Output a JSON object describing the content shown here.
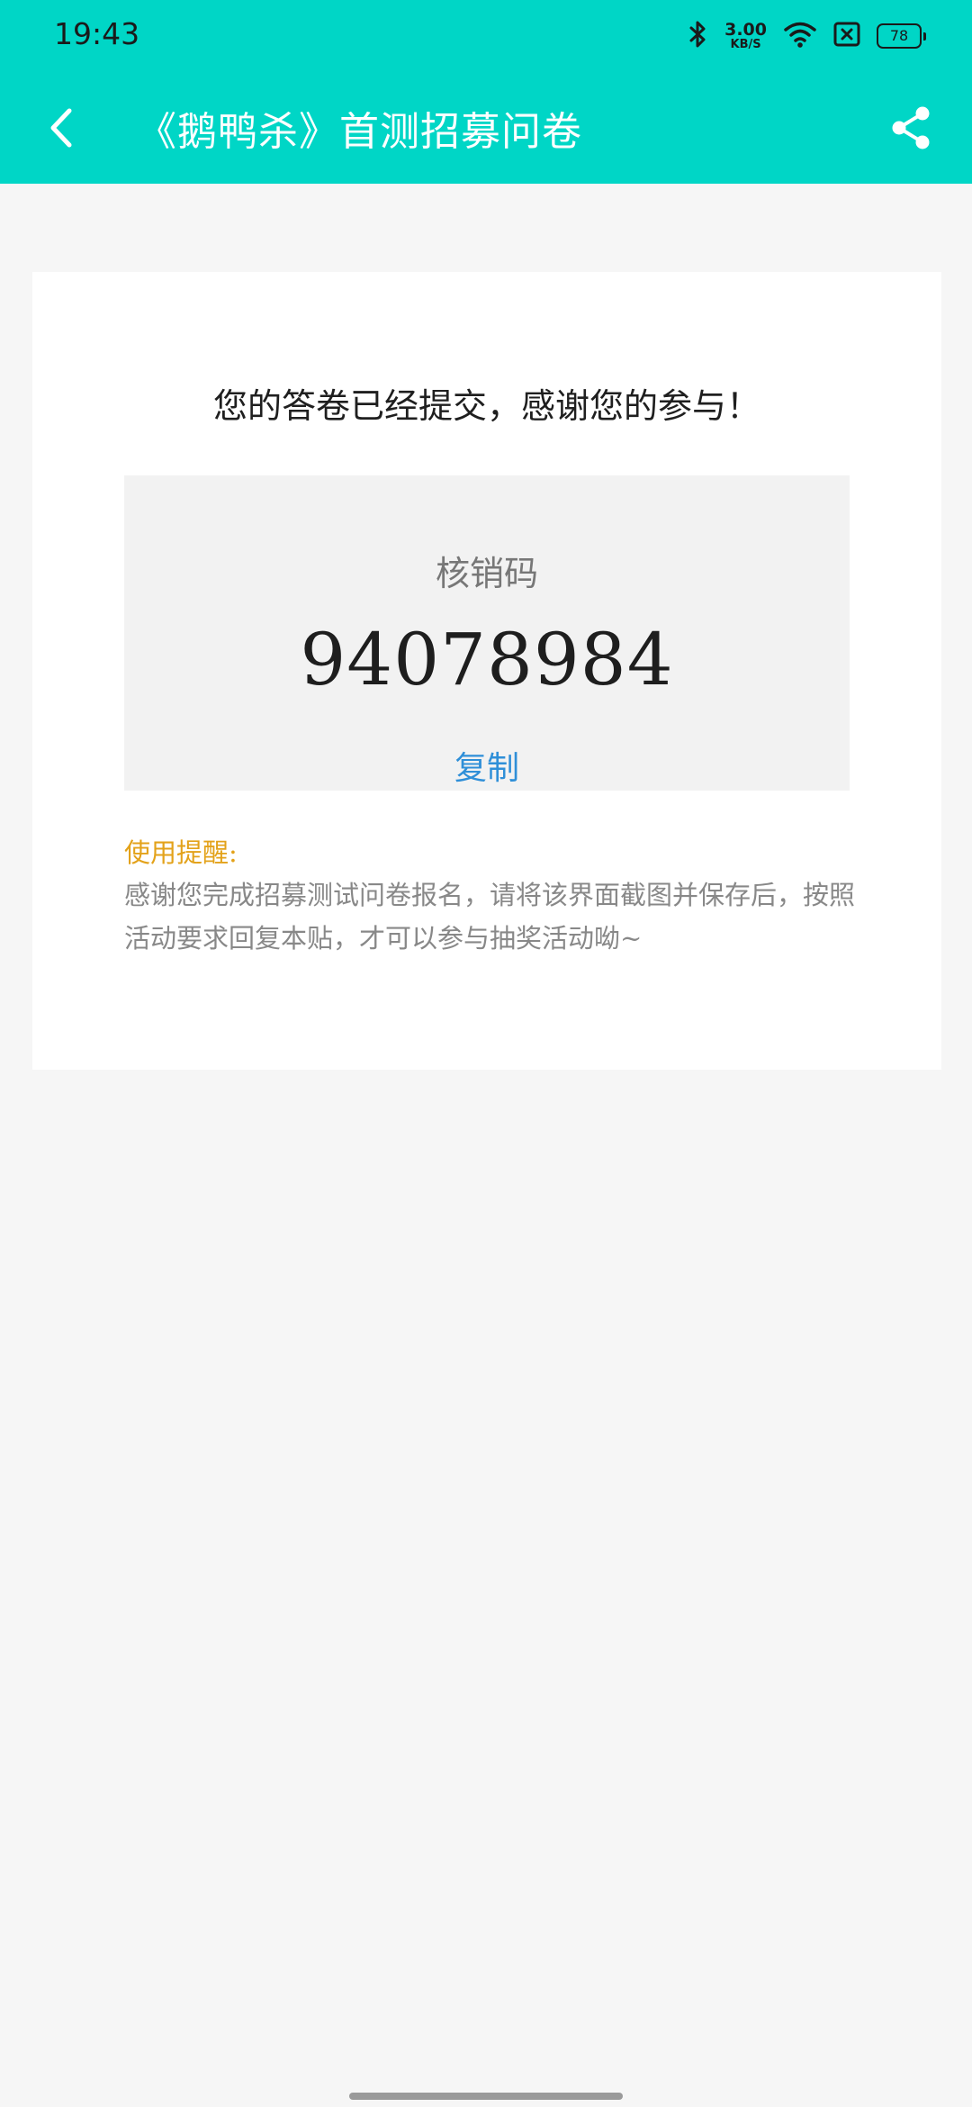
{
  "status_bar": {
    "time": "19:43",
    "net_speed_value": "3.00",
    "net_speed_unit": "KB/S",
    "battery_level": "78",
    "icons": [
      "bluetooth-icon",
      "wifi-icon",
      "sim-error-icon",
      "battery-icon"
    ]
  },
  "header": {
    "title": "《鹅鸭杀》首测招募问卷",
    "back_icon": "chevron-left-icon",
    "share_icon": "share-icon",
    "background_color": "#00d6c6"
  },
  "result_card": {
    "message": "您的答卷已经提交，感谢您的参与！",
    "code_label": "核销码",
    "code_value": "94078984",
    "copy_label": "复制",
    "tip_title": "使用提醒:",
    "tip_text": "感谢您完成招募测试问卷报名，请将该界面截图并保存后，按照活动要求回复本贴，才可以参与抽奖活动呦~"
  },
  "colors": {
    "accent": "#00d6c6",
    "link": "#2f8fd8",
    "warning": "#e3a21a"
  }
}
